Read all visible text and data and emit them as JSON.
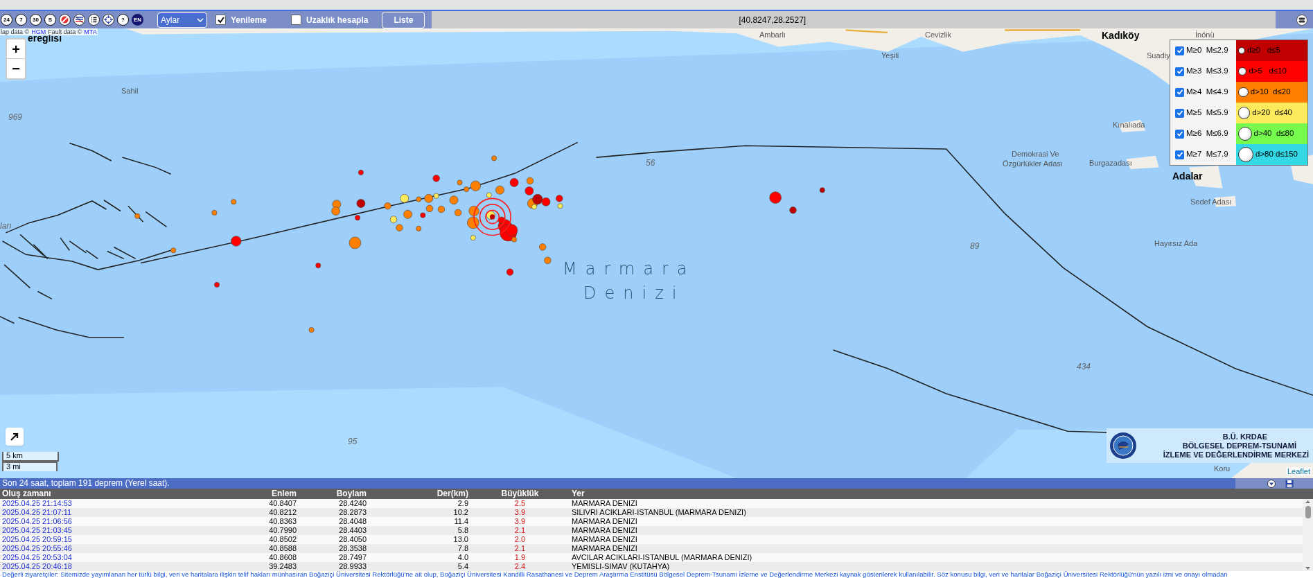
{
  "toolbar": {
    "icon_buttons": [
      {
        "kind": "text",
        "text": "24"
      },
      {
        "kind": "text",
        "text": "7"
      },
      {
        "kind": "text",
        "text": "30"
      },
      {
        "kind": "text",
        "text": "S"
      },
      {
        "kind": "no-entry"
      },
      {
        "kind": "flag"
      },
      {
        "kind": "list"
      },
      {
        "kind": "crosshair"
      },
      {
        "kind": "text",
        "text": "?"
      },
      {
        "kind": "lang",
        "text": "EN"
      }
    ],
    "period_select": {
      "value": "Aylar"
    },
    "checkboxes": [
      {
        "label": "Yenileme",
        "checked": true
      },
      {
        "label": "Uzaklık hesapla",
        "checked": false
      }
    ],
    "list_button": "Liste",
    "coordinates": "[40.8247,28.2527]"
  },
  "map": {
    "attribution": [
      {
        "text": "lap data ©",
        "link": false
      },
      {
        "text": "HGM",
        "link": true
      },
      {
        "text": "Fault data ©",
        "link": false
      },
      {
        "text": "MTA",
        "link": true
      }
    ],
    "zoom": {
      "in": "+",
      "out": "−"
    },
    "labels": [
      {
        "kind": "town",
        "text": "ereğlisi"
      },
      {
        "kind": "depth",
        "text": "969"
      },
      {
        "kind": "place",
        "text": "Sahil"
      },
      {
        "kind": "place",
        "text": "Ambarlı"
      },
      {
        "kind": "place",
        "text": "Yeşili"
      },
      {
        "kind": "place",
        "text": "Cevizlik"
      },
      {
        "kind": "town",
        "text": "Kadıköy"
      },
      {
        "kind": "place",
        "text": "İnönü"
      },
      {
        "kind": "place",
        "text": "Suadiy"
      },
      {
        "kind": "place",
        "text": "Kınalıada"
      },
      {
        "kind": "place",
        "text": "Burgazadası"
      },
      {
        "kind": "place",
        "text": "Demokrasi Ve"
      },
      {
        "kind": "place",
        "text": "Özgürlükler Adası"
      },
      {
        "kind": "town",
        "text": "Adalar"
      },
      {
        "kind": "place",
        "text": "Sedef Adası"
      },
      {
        "kind": "place",
        "text": "Hayırsız Ada"
      },
      {
        "kind": "place",
        "text": "Koru"
      },
      {
        "kind": "depth",
        "text": "ları"
      },
      {
        "kind": "depth",
        "text": "56"
      },
      {
        "kind": "depth",
        "text": "89"
      },
      {
        "kind": "depth",
        "text": "434"
      },
      {
        "kind": "depth",
        "text": "95"
      },
      {
        "kind": "sea",
        "text": "Marmara"
      },
      {
        "kind": "sea",
        "text": "Denizi"
      }
    ],
    "legend": {
      "magnitudes": [
        {
          "label": "M≥0  M≤2.9",
          "checked": true
        },
        {
          "label": "M≥3  M≤3.9",
          "checked": true
        },
        {
          "label": "M≥4  M≤4.9",
          "checked": true
        },
        {
          "label": "M≥5  M≤5.9",
          "checked": true
        },
        {
          "label": "M≥6  M≤6.9",
          "checked": true
        },
        {
          "label": "M≥7  M≤7.9",
          "checked": true
        }
      ],
      "depths": [
        {
          "label": "d≥0   d≤5",
          "color": "#c00000"
        },
        {
          "label": "d>5   d≤10",
          "color": "#ff0000"
        },
        {
          "label": "d>10  d≤20",
          "color": "#ff8000"
        },
        {
          "label": "d>20  d≤40",
          "color": "#fce95c"
        },
        {
          "label": "d>40  d≤80",
          "color": "#77fb4f"
        },
        {
          "label": "d>80 d≤150",
          "color": "#35d9e5"
        }
      ]
    },
    "logo": {
      "lines": [
        "B.Ü. KRDAE",
        "BÖLGESEL DEPREM-TSUNAMİ",
        "İZLEME VE DEĞERLENDİRME MERKEZİ"
      ]
    },
    "scale": [
      "5 km",
      "3 mi"
    ],
    "leaflet": "Leaflet"
  },
  "list": {
    "summary": "Son 24 saat, toplam 191 deprem (Yerel saat).",
    "columns": [
      "Oluş zamanı",
      "Enlem",
      "Boylam",
      "Der(km)",
      "Büyüklük",
      "Yer"
    ],
    "rows": [
      [
        "2025.04.25 21:14:53",
        "40.8407",
        "28.4240",
        "2.9",
        "2.5",
        "MARMARA DENIZI"
      ],
      [
        "2025.04.25 21:07:11",
        "40.8212",
        "28.2873",
        "10.2",
        "3.9",
        "SILIVRI ACIKLARI-ISTANBUL (MARMARA DENIZI)"
      ],
      [
        "2025.04.25 21:06:56",
        "40.8363",
        "28.4048",
        "11.4",
        "3.9",
        "MARMARA DENIZI"
      ],
      [
        "2025.04.25 21:03:45",
        "40.7990",
        "28.4403",
        "5.8",
        "2.1",
        "MARMARA DENIZI"
      ],
      [
        "2025.04.25 20:59:15",
        "40.8502",
        "28.4050",
        "13.0",
        "2.0",
        "MARMARA DENIZI"
      ],
      [
        "2025.04.25 20:55:46",
        "40.8588",
        "28.3538",
        "7.8",
        "2.1",
        "MARMARA DENIZI"
      ],
      [
        "2025.04.25 20:53:04",
        "40.8608",
        "28.7497",
        "4.0",
        "1.9",
        "AVCILAR ACIKLARI-ISTANBUL (MARMARA DENIZI)"
      ],
      [
        "2025.04.25 20:46:18",
        "39.2483",
        "28.9933",
        "5.4",
        "2.4",
        "YEMISLI-SIMAV (KUTAHYA)"
      ]
    ],
    "footer": "Değerli ziyaretçiler: Sitemizde yayımlanan her türlü bilgi, veri ve haritalara ilişkin telif hakları münhasıran Boğaziçi Üniversitesi Rektörlüğü'ne ait olup, Boğaziçi Üniversitesi Kandilli Rasathanesi ve Deprem Araştırma Enstitüsü Bölgesel Deprem-Tsunami İzleme ve Değerlendirme Merkezi kaynak gösterilerek kullanılabilir. Söz konusu bilgi, veri ve haritalar Boğaziçi Üniversitesi Rektörlüğü'nün yazılı izni ve onayı olmadan"
  }
}
